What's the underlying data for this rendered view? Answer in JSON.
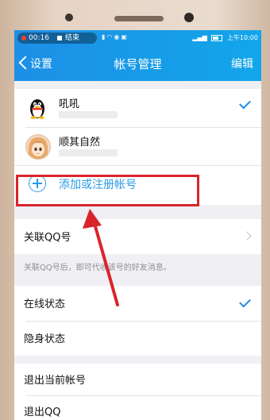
{
  "status_bar": {
    "record_time": "00:16",
    "record_end": "结束",
    "clock": "上午10:00"
  },
  "nav": {
    "back_label": "设置",
    "title": "帐号管理",
    "edit_label": "编辑"
  },
  "accounts": [
    {
      "name": "吼吼",
      "selected": true,
      "avatar_icon": "qq-penguin-icon"
    },
    {
      "name": "顺其自然",
      "selected": false,
      "avatar_icon": "anime-avatar-icon"
    }
  ],
  "add_account": {
    "label": "添加或注册帐号"
  },
  "link_qq": {
    "label": "关联QQ号",
    "hint": "关联QQ号后，即可代收该号的好友消息。"
  },
  "online_status": {
    "label": "在线状态",
    "selected": true
  },
  "invisible_status": {
    "label": "隐身状态",
    "selected": false
  },
  "logout_current": {
    "label": "退出当前帐号"
  },
  "quit_qq": {
    "label": "退出QQ"
  },
  "colors": {
    "accent": "#2b9ae8",
    "nav_bar": "#1d8fe6",
    "annotation_red": "#d9242b"
  }
}
